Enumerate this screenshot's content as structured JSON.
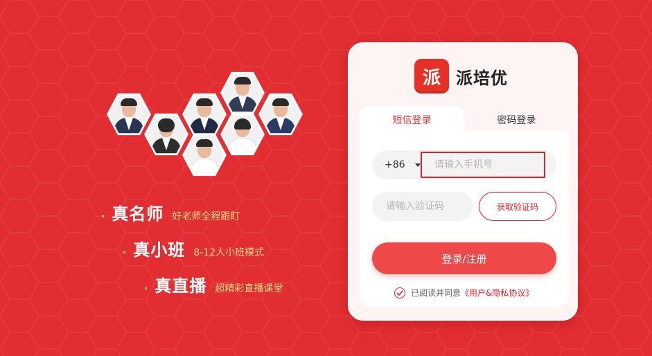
{
  "colors": {
    "background": "#e22d32",
    "accent": "#e0232b",
    "button": "#ef4848",
    "feature_sub": "#ffd98a"
  },
  "features": [
    {
      "dot": "·",
      "title": "真名师",
      "subtitle": "好老师全程跟盯"
    },
    {
      "dot": "·",
      "title": "真小班",
      "subtitle": "8-12人小班模式"
    },
    {
      "dot": "·",
      "title": "真直播",
      "subtitle": "超精彩直播课堂"
    }
  ],
  "brand": {
    "logo_char": "派",
    "name": "派培优"
  },
  "tabs": {
    "sms": "短信登录",
    "password": "密码登录"
  },
  "form": {
    "country_code": "+86",
    "phone_placeholder": "请输入手机号",
    "code_placeholder": "请输入验证码",
    "get_code_label": "获取验证码",
    "submit_label": "登录/注册",
    "agree_text": "已阅读并同意",
    "agreement_link": "《用户&隐私协议》"
  }
}
